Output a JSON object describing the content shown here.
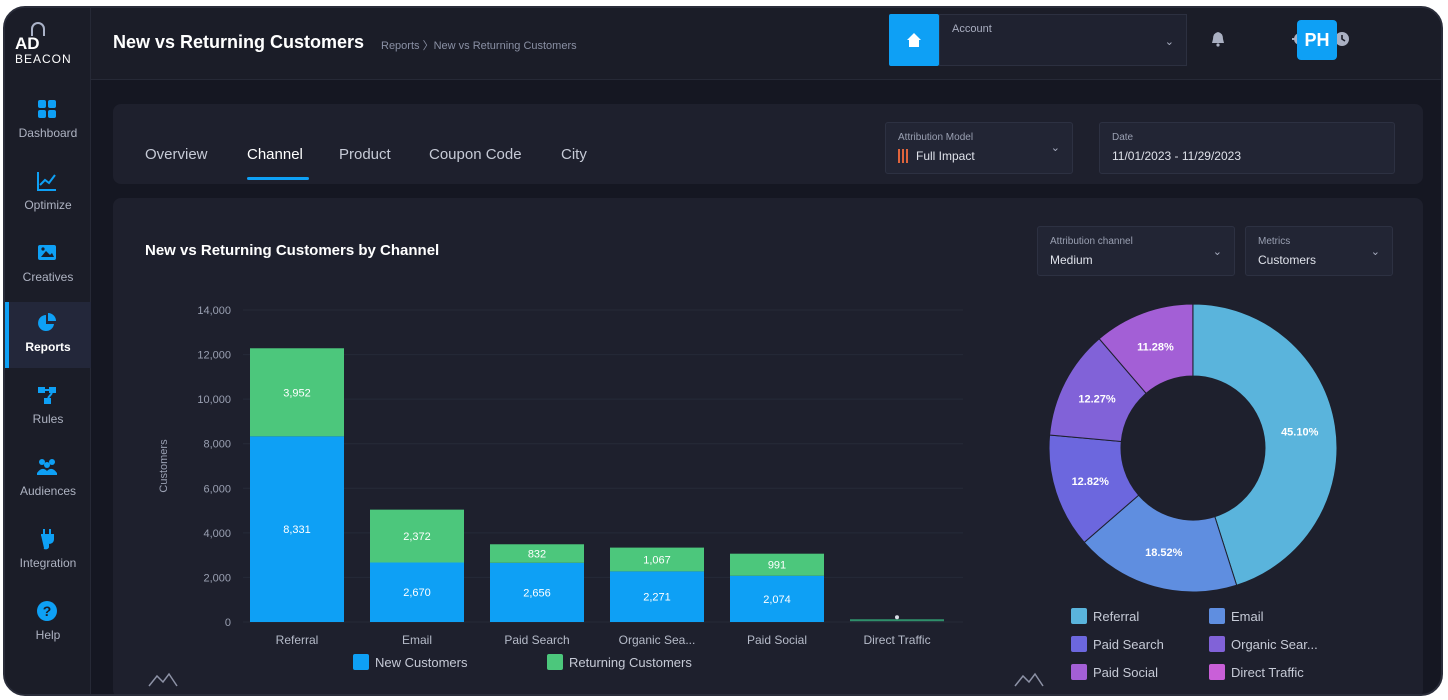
{
  "app": {
    "logo_line1": "AD",
    "logo_line2": "BEACON",
    "page_title": "New vs Returning Customers",
    "breadcrumb": "Reports 〉New vs Returning Customers",
    "avatar_initials": "PH",
    "accent_color": "#0ea0f5"
  },
  "sidebar": {
    "items": [
      {
        "label": "Dashboard",
        "icon": "dashboard-grid-icon"
      },
      {
        "label": "Optimize",
        "icon": "line-chart-icon"
      },
      {
        "label": "Creatives",
        "icon": "image-icon"
      },
      {
        "label": "Reports",
        "icon": "pie-chart-icon",
        "active": true
      },
      {
        "label": "Rules",
        "icon": "flow-icon"
      },
      {
        "label": "Audiences",
        "icon": "people-icon"
      },
      {
        "label": "Integration",
        "icon": "plug-icon"
      },
      {
        "label": "Help",
        "icon": "help-icon"
      }
    ]
  },
  "topbar": {
    "account_label": "Account",
    "account_value": ""
  },
  "tabs": [
    {
      "label": "Overview"
    },
    {
      "label": "Channel",
      "active": true
    },
    {
      "label": "Product"
    },
    {
      "label": "Coupon Code"
    },
    {
      "label": "City"
    }
  ],
  "filters": {
    "attribution_model_label": "Attribution Model",
    "attribution_model_value": "Full Impact",
    "date_label": "Date",
    "date_value": "11/01/2023 - 11/29/2023"
  },
  "panel": {
    "title": "New vs Returning Customers by Channel",
    "attribution_channel_label": "Attribution channel",
    "attribution_channel_value": "Medium",
    "metrics_label": "Metrics",
    "metrics_value": "Customers"
  },
  "chart_data": [
    {
      "type": "bar",
      "stacked": true,
      "title": "",
      "ylabel": "Customers",
      "xlabel": "",
      "ylim": [
        0,
        14000
      ],
      "yticks": [
        0,
        2000,
        4000,
        6000,
        8000,
        10000,
        12000,
        14000
      ],
      "ytick_labels": [
        "0",
        "2,000",
        "4,000",
        "6,000",
        "8,000",
        "10,000",
        "12,000",
        "14,000"
      ],
      "categories": [
        "Referral",
        "Email",
        "Paid Search",
        "Organic Sea...",
        "Paid Social",
        "Direct Traffic"
      ],
      "series": [
        {
          "name": "New Customers",
          "color": "#0ea0f5",
          "values": [
            8331,
            2670,
            2656,
            2271,
            2074,
            60
          ],
          "labels": [
            "8,331",
            "2,670",
            "2,656",
            "2,271",
            "2,074",
            ""
          ]
        },
        {
          "name": "Returning Customers",
          "color": "#4cc77c",
          "values": [
            3952,
            2372,
            832,
            1067,
            991,
            20
          ],
          "labels": [
            "3,952",
            "2,372",
            "832",
            "1,067",
            "991",
            ""
          ]
        }
      ],
      "legend": "bottom"
    },
    {
      "type": "pie",
      "donut": true,
      "title": "",
      "slices": [
        {
          "name": "Referral",
          "value": 45.1,
          "label": "45.10%",
          "color": "#5ab4dc"
        },
        {
          "name": "Email",
          "value": 18.52,
          "label": "18.52%",
          "color": "#5f8ee0"
        },
        {
          "name": "Paid Search",
          "value": 12.82,
          "label": "12.82%",
          "color": "#6c67de"
        },
        {
          "name": "Organic Sear...",
          "value": 12.27,
          "label": "12.27%",
          "color": "#8162d8"
        },
        {
          "name": "Paid Social",
          "value": 11.28,
          "label": "11.28%",
          "color": "#a35fd6"
        },
        {
          "name": "Direct Traffic",
          "value": 0.01,
          "label": "",
          "color": "#c95fd8"
        }
      ],
      "legend": "bottom"
    }
  ]
}
